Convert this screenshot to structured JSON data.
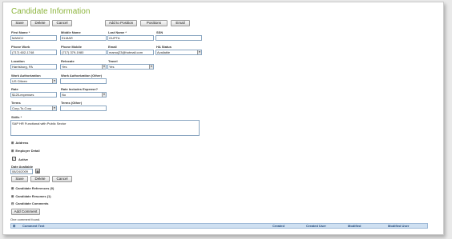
{
  "page": {
    "title": "Candidate Information"
  },
  "toolbar": {
    "save": "Save",
    "delete": "Delete",
    "cancel": "Cancel",
    "add_to_position": "Add to Position",
    "positions": "Positions",
    "email": "Email"
  },
  "fields": {
    "first_name": {
      "label": "First Name *",
      "value": "MANOJ"
    },
    "middle_name": {
      "label": "Middle Name",
      "value": "ELMAR"
    },
    "last_name": {
      "label": "Last Name *",
      "value": "GUPTA"
    },
    "ssn": {
      "label": "SSN",
      "value": ""
    },
    "phone_work": {
      "label": "Phone Work",
      "value": "(717) 602-1748"
    },
    "phone_mobile": {
      "label": "Phone Mobile",
      "value": "(717) 379-1980"
    },
    "email": {
      "label": "Email",
      "value": "mamoj23@hotmail.com"
    },
    "ha_status": {
      "label": "HA Status",
      "value": "Available"
    },
    "location": {
      "label": "Location",
      "value": "Harrisburg, PA"
    },
    "relocate": {
      "label": "Relocate",
      "value": "Yes"
    },
    "travel": {
      "label": "Travel",
      "value": "Yes"
    },
    "work_auth": {
      "label": "Work Authorization",
      "value": "US Citizen"
    },
    "work_auth_other": {
      "label": "Work Authorization (Other)",
      "value": ""
    },
    "rate": {
      "label": "Rate",
      "value": "$125-expenses"
    },
    "rate_includes_expense": {
      "label": "Rate Includes Expense?",
      "value": "No"
    },
    "terms": {
      "label": "Terms",
      "value": "Corp-To-Corp"
    },
    "terms_other": {
      "label": "Terms (Other)",
      "value": ""
    },
    "skills": {
      "label": "Skills *",
      "value": "SAP HR Functional with Public Sector"
    },
    "active": {
      "label": "Active"
    },
    "date_available": {
      "label": "Date Available",
      "value": "08/24/2009"
    }
  },
  "sections": {
    "address": "Address",
    "employer_detail": "Employer Detail",
    "candidate_references": "Candidate References (0)",
    "candidate_resumes": "Candidate Resumes (1)",
    "candidate_comments": "Candidate Comments"
  },
  "comments": {
    "add_button": "Add Comment",
    "found_text": "One comment found.",
    "columns": [
      "Comment Text",
      "Created",
      "Created User",
      "Modified",
      "Modified User"
    ]
  },
  "colors": {
    "title": "#8db53e",
    "grid_header": "#cfe0f1"
  }
}
